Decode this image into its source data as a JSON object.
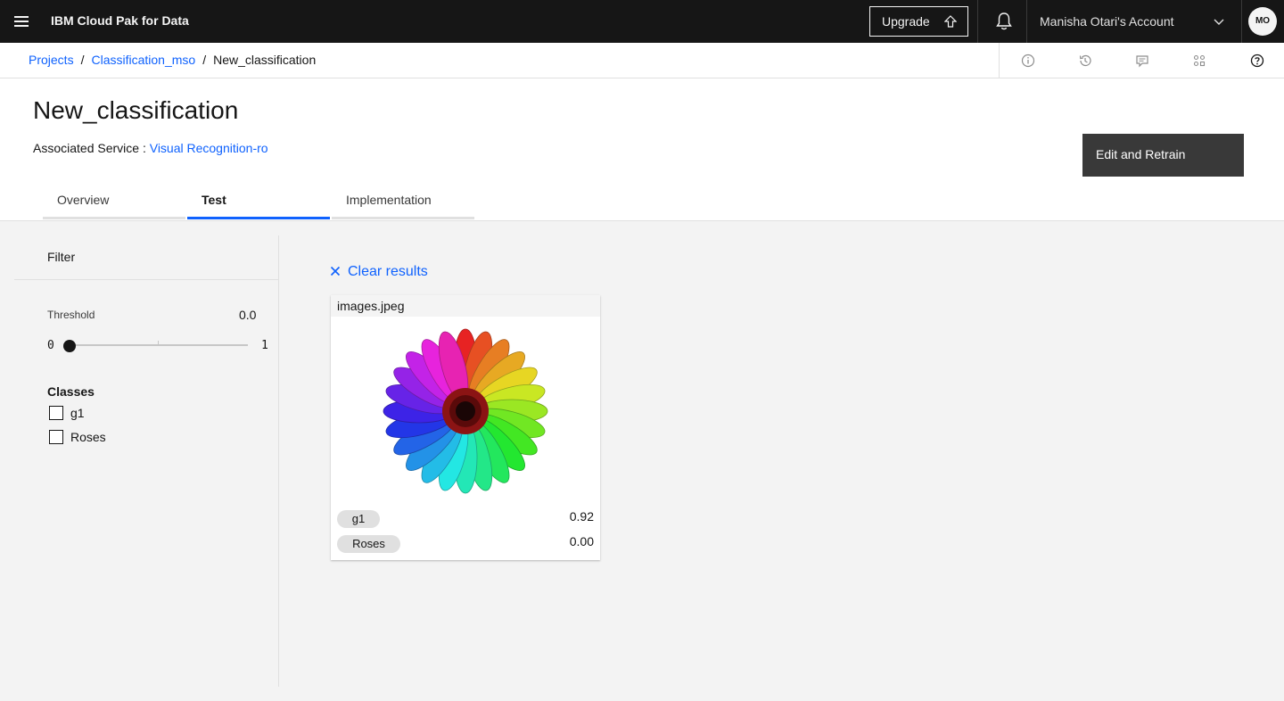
{
  "header": {
    "brand": "IBM Cloud Pak for Data",
    "upgrade_label": "Upgrade",
    "account_label": "Manisha Otari's Account",
    "avatar_initials": "MO"
  },
  "breadcrumb": {
    "items": [
      "Projects",
      "Classification_mso"
    ],
    "current": "New_classification"
  },
  "page": {
    "title": "New_classification",
    "service_label": "Associated Service :",
    "service_link": "Visual Recognition-ro",
    "retrain_label": "Edit and Retrain",
    "tabs": [
      {
        "label": "Overview",
        "active": false
      },
      {
        "label": "Test",
        "active": true
      },
      {
        "label": "Implementation",
        "active": false
      }
    ]
  },
  "filter": {
    "title": "Filter",
    "threshold_label": "Threshold",
    "threshold_value": "0.0",
    "slider_min": "0",
    "slider_max": "1",
    "classes_title": "Classes",
    "classes": [
      {
        "label": "g1",
        "checked": false
      },
      {
        "label": "Roses",
        "checked": false
      }
    ]
  },
  "results": {
    "clear_label": "Clear results",
    "card": {
      "filename": "images.jpeg",
      "scores": [
        {
          "label": "g1",
          "score": "0.92"
        },
        {
          "label": "Roses",
          "score": "0.00"
        }
      ]
    }
  },
  "colors": {
    "accent": "#0f62fe",
    "header_bg": "#161616",
    "button_bg": "#393939"
  }
}
